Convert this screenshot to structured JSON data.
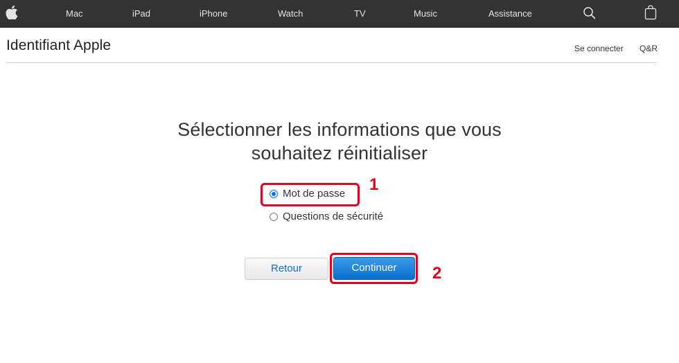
{
  "globalnav": {
    "logo_icon": "apple-logo-icon",
    "items": [
      {
        "label": "Mac"
      },
      {
        "label": "iPad"
      },
      {
        "label": "iPhone"
      },
      {
        "label": "Watch"
      },
      {
        "label": "TV"
      },
      {
        "label": "Music"
      },
      {
        "label": "Assistance"
      }
    ],
    "search_icon": "search-icon",
    "bag_icon": "bag-icon"
  },
  "localnav": {
    "title": "Identifiant Apple",
    "links": [
      {
        "label": "Se connecter"
      },
      {
        "label": "Q&R"
      }
    ]
  },
  "main": {
    "headline_line1": "Sélectionner les informations que vous",
    "headline_line2": "souhaitez réinitialiser",
    "options": [
      {
        "label": "Mot de passe",
        "checked": true
      },
      {
        "label": "Questions de sécurité",
        "checked": false
      }
    ],
    "back_label": "Retour",
    "continue_label": "Continuer"
  },
  "annotations": {
    "step1": "1",
    "step2": "2",
    "color": "#e3001b"
  },
  "colors": {
    "nav_bg": "#333333",
    "primary_button": "#0a6fcc",
    "link_blue": "#0f6dca"
  }
}
